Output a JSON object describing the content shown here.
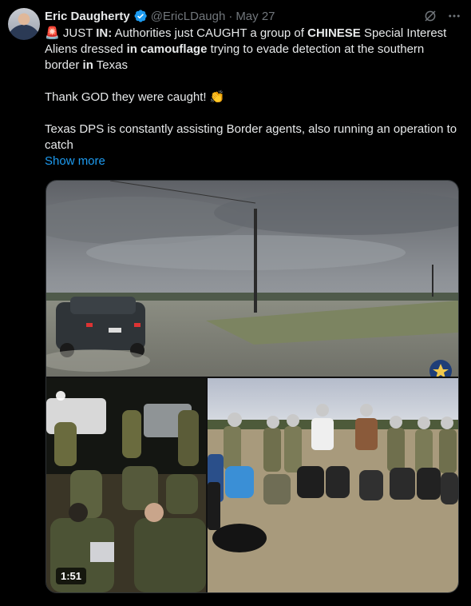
{
  "author": {
    "display_name": "Eric Daugherty",
    "handle": "@EricLDaugh",
    "separator": "·",
    "date": "May 27"
  },
  "tweet": {
    "emoji_alert": "🚨",
    "part1_a": "JUST ",
    "part1_b": "IN:",
    "part1_c": " Authorities just CAUGHT a group of ",
    "part1_d": "CHINESE",
    "part1_e": " Special Interest Aliens dressed ",
    "part1_f": "in camouflage",
    "part1_g": " trying to evade detection at the southern border ",
    "part1_h": "in",
    "part1_i": " Texas",
    "line2": "Thank GOD they were caught!",
    "emoji_clap": "👏",
    "line3": "Texas DPS is constantly assisting Border agents, also running an operation to catch",
    "show_more": "Show more"
  },
  "media": {
    "duration": "1:51"
  },
  "icons": {
    "verified": "verified-badge-icon",
    "grok": "grok-icon",
    "more": "more-dots-icon"
  },
  "colors": {
    "link": "#1d9bf0",
    "verified": "#1d9bf0",
    "muted": "#71767b"
  }
}
